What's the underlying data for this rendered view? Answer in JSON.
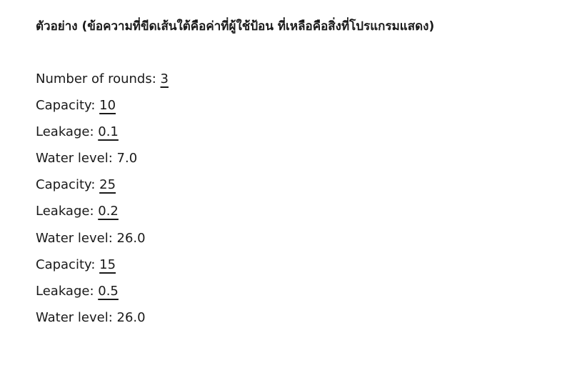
{
  "heading": "ตัวอย่าง (ข้อความที่ขีดเส้นใต้คือค่าที่ผู้ใช้ป้อน ที่เหลือคือสิ่งที่โปรแกรมแสดง)",
  "lines": [
    {
      "label": "Number of rounds: ",
      "value": "3",
      "is_input": true
    },
    {
      "label": "Capacity: ",
      "value": "10",
      "is_input": true
    },
    {
      "label": "Leakage: ",
      "value": "0.1",
      "is_input": true
    },
    {
      "label": "Water level: ",
      "value": "7.0",
      "is_input": false
    },
    {
      "label": "Capacity: ",
      "value": "25",
      "is_input": true
    },
    {
      "label": "Leakage: ",
      "value": "0.2",
      "is_input": true
    },
    {
      "label": "Water level: ",
      "value": "26.0",
      "is_input": false
    },
    {
      "label": "Capacity: ",
      "value": "15",
      "is_input": true
    },
    {
      "label": "Leakage: ",
      "value": "0.5",
      "is_input": true
    },
    {
      "label": "Water level: ",
      "value": "26.0",
      "is_input": false
    }
  ]
}
